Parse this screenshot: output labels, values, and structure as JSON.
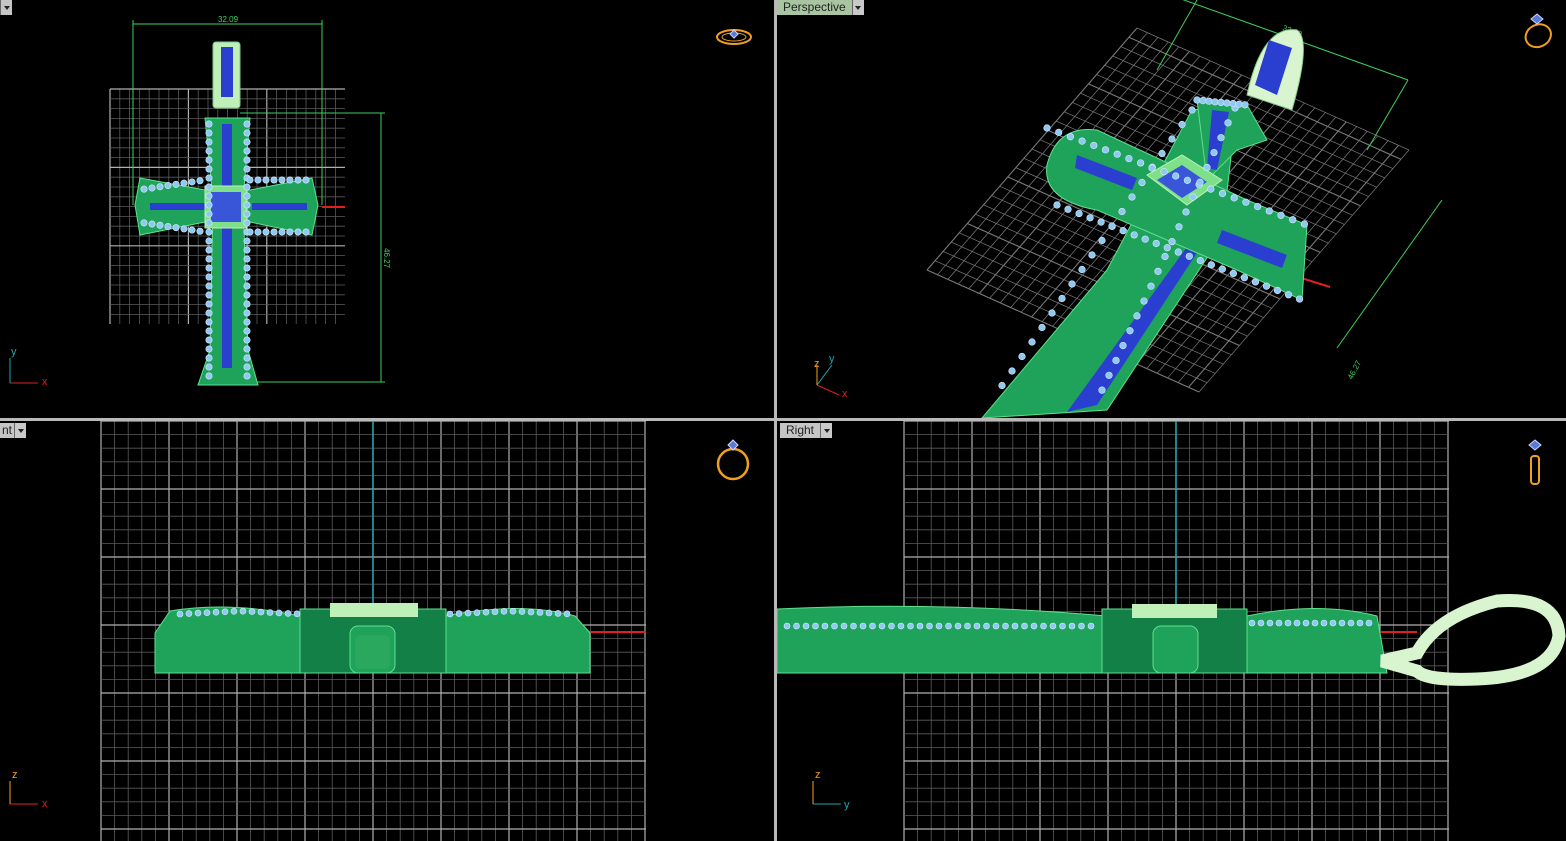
{
  "viewports": {
    "top": {
      "label": "",
      "dim_width": "32.09",
      "dim_height": "46.27",
      "axis_h": "x",
      "axis_v": "y"
    },
    "perspective": {
      "label": "Perspective",
      "dim_width": "32.09",
      "dim_height": "46.27",
      "axis_z": "z",
      "axis_y": "y",
      "axis_x": "x"
    },
    "front": {
      "label": "nt",
      "axis_h": "x",
      "axis_v": "z"
    },
    "right": {
      "label": "Right",
      "axis_h": "y",
      "axis_v": "z"
    }
  },
  "colors": {
    "background": "#000000",
    "grid": "#8c8c8c",
    "model_green": "#1fa35a",
    "model_light": "#bff0b8",
    "gem_blue": "#2a3fcf",
    "diamond": "#8fc8f0",
    "dimension": "#3bd15c",
    "x_axis": "#e02020",
    "vertical_axis": "#1aa6b0",
    "view_cube": "#f0a020"
  },
  "icons": [
    "ring-top-view-icon",
    "ring-perspective-icon",
    "ring-front-view-icon",
    "ring-side-view-icon"
  ]
}
